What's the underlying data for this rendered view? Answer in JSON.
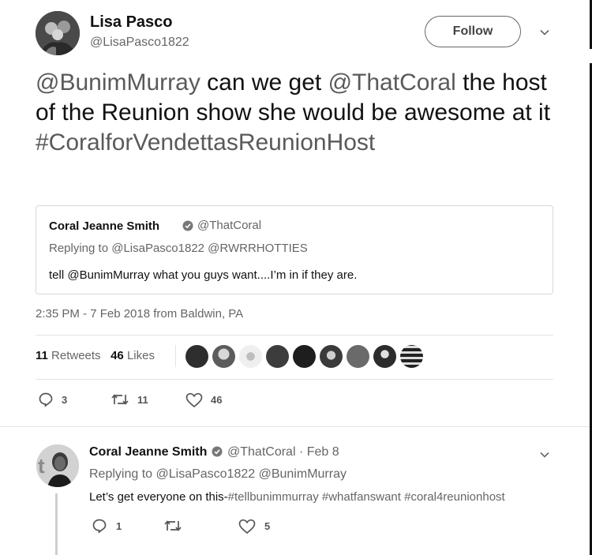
{
  "tweet": {
    "author_name": "Lisa Pasco",
    "author_handle": "@LisaPasco1822",
    "follow_label": "Follow",
    "text_mention_1": "@BunimMurray",
    "text_part_1": " can we get ",
    "text_mention_2": "@ThatCoral",
    "text_part_2": " the host of the Reunion show she would be awesome at it",
    "text_hashtag": "#CoralforVendettasReunionHost",
    "timestamp": "2:35 PM - 7 Feb 2018 from Baldwin, PA",
    "retweets_count": "11",
    "retweets_label": "Retweets",
    "likes_count": "46",
    "likes_label": "Likes",
    "actions": {
      "replies": "3",
      "retweets": "11",
      "likes": "46"
    }
  },
  "quoted_tweet": {
    "author_name": "Coral Jeanne Smith",
    "author_handle": "@ThatCoral",
    "replying_to": "Replying to @LisaPasco1822 @RWRRHOTTIES",
    "text": "tell @BunimMurray what you guys want....I’m in if they are."
  },
  "reply": {
    "author_name": "Coral Jeanne Smith",
    "handle_date": "@ThatCoral · Feb 8",
    "replying_to": "Replying to @LisaPasco1822 @BunimMurray",
    "text_plain": "Let’s get everyone on this-",
    "text_tags": "#tellbunimmurray #whatfanswant #coral4reunionhost",
    "actions": {
      "replies": "1",
      "retweets": "",
      "likes": "5"
    }
  },
  "colors": {
    "text": "#111111",
    "muted": "#666666",
    "border": "#d8d8d8",
    "mention": "#5a5a5a"
  }
}
